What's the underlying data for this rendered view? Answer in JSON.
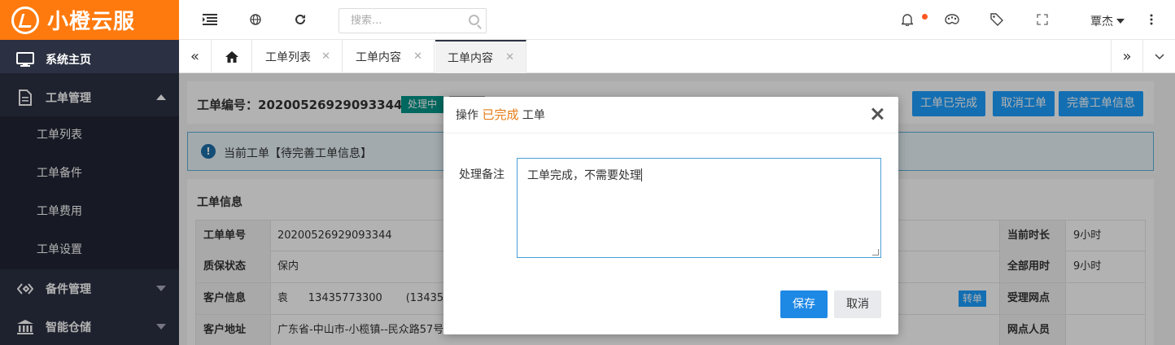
{
  "app": {
    "brand": "小橙云服",
    "brand_color": "#ff7a0e"
  },
  "sidebar": {
    "items": [
      {
        "label": "系统主页",
        "icon": "monitor-icon"
      },
      {
        "label": "工单管理",
        "icon": "document-icon",
        "expanded": true
      },
      {
        "label": "备件管理",
        "icon": "parts-icon"
      },
      {
        "label": "智能仓储",
        "icon": "warehouse-icon"
      }
    ],
    "sub_items": [
      "工单列表",
      "工单备件",
      "工单费用",
      "工单设置"
    ]
  },
  "topbar": {
    "search_placeholder": "搜索...",
    "user_name": "覃杰",
    "icons": [
      "menu-collapse-icon",
      "globe-icon",
      "refresh-icon",
      "bell-icon",
      "palette-icon",
      "tag-icon",
      "fullscreen-icon",
      "more-icon"
    ]
  },
  "tabs": [
    {
      "label": "工单列表"
    },
    {
      "label": "工单内容"
    },
    {
      "label": "工单内容",
      "active": true
    }
  ],
  "order": {
    "title_label": "工单编号：",
    "number": "20200526929093344",
    "status_badge": "处理中",
    "buttons": [
      "工单已完成",
      "取消工单",
      "完善工单信息"
    ]
  },
  "alert": {
    "text": "当前工单【待完善工单信息】"
  },
  "info": {
    "title": "工单信息",
    "rows": [
      {
        "label": "工单单号",
        "value": "20200526929093344",
        "r_label": "当前时长",
        "r_value": "9小时"
      },
      {
        "label": "质保状态",
        "value": "保内",
        "r_label": "全部用时",
        "r_value": "9小时"
      },
      {
        "label": "客户信息",
        "value": "袁      13435773300       (13435",
        "r_label": "受理网点",
        "r_value": ""
      },
      {
        "label": "客户地址",
        "value": "广东省-中山市-小榄镇--民众路57号",
        "r_label": "网点人员",
        "r_value": ""
      }
    ],
    "transfer_label": "转单"
  },
  "modal": {
    "prefix": "操作",
    "highlight": "已完成",
    "suffix": "工单",
    "field_label": "处理备注",
    "field_value": "工单完成，不需要处理",
    "save_label": "保存",
    "cancel_label": "取消"
  }
}
